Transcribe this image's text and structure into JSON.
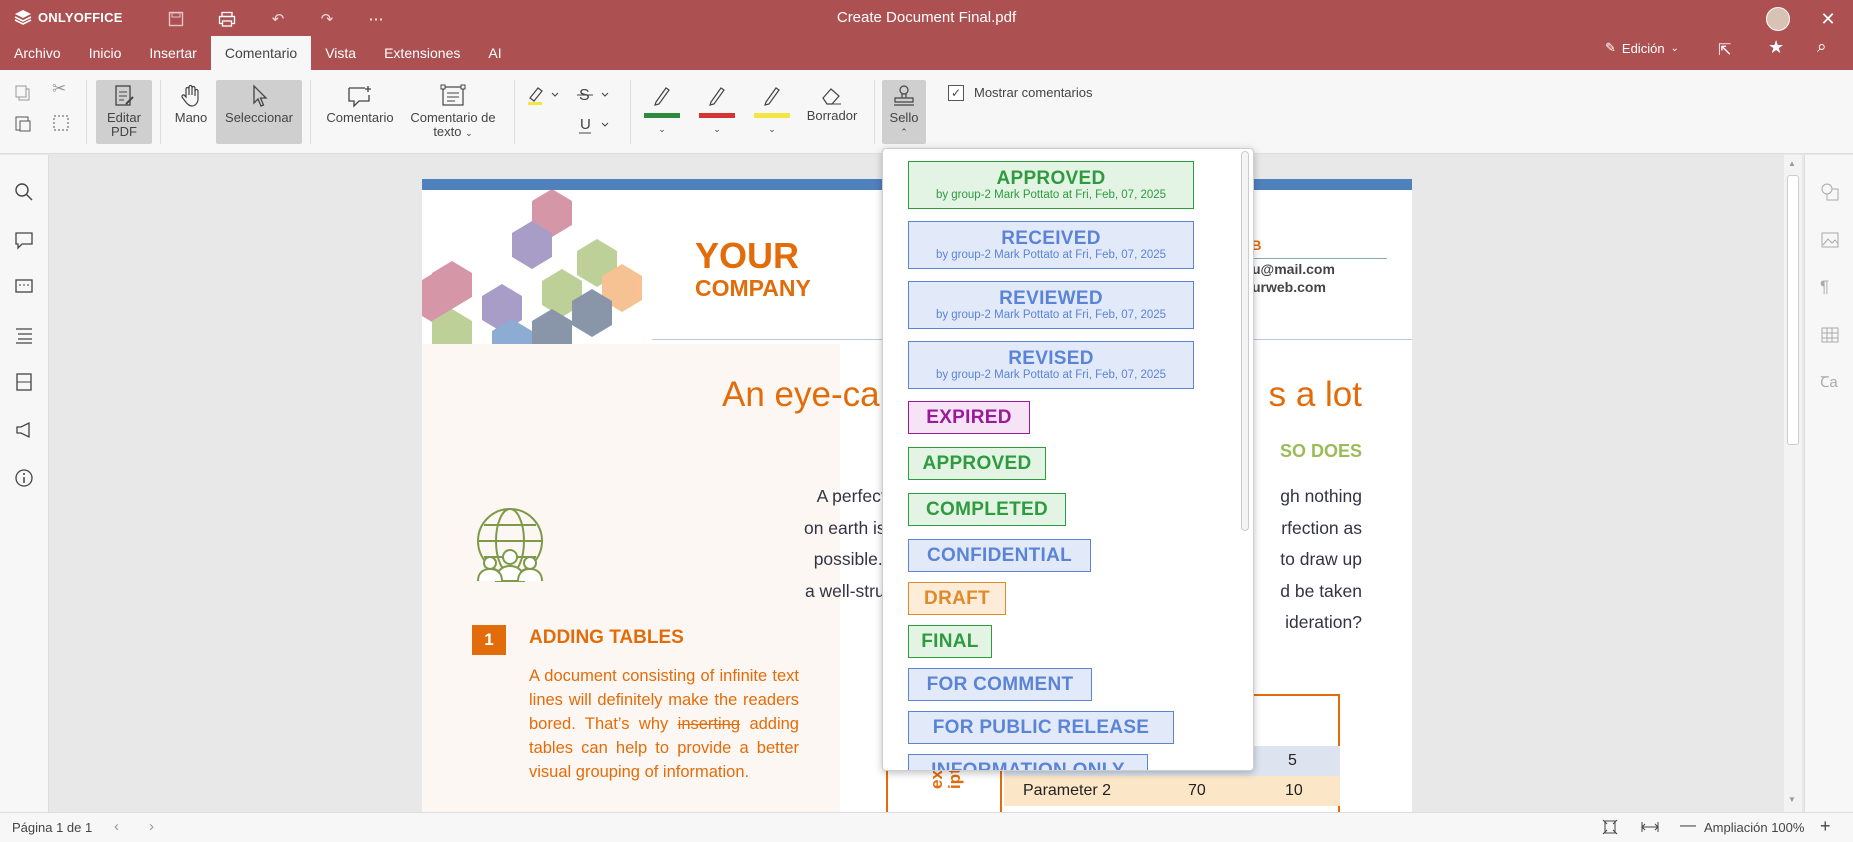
{
  "app": {
    "name": "ONLYOFFICE",
    "document_title": "Create Document Final.pdf"
  },
  "menu": {
    "items": [
      "Archivo",
      "Inicio",
      "Insertar",
      "Comentario",
      "Vista",
      "Extensiones",
      "AI"
    ],
    "active": "Comentario"
  },
  "header_right": {
    "mode_label": "Edición"
  },
  "ribbon": {
    "edit_pdf": "Editar PDF",
    "hand": "Mano",
    "select": "Seleccionar",
    "comment": "Comentario",
    "text_comment": "Comentario de texto",
    "eraser": "Borrador",
    "stamp": "Sello",
    "show_comments": "Mostrar comentarios",
    "pen_colors": [
      "#2e8b3e",
      "#d63333",
      "#f3e544"
    ],
    "highlight_color": "#f3e544"
  },
  "stamps": [
    {
      "label": "APPROVED",
      "sub": "by group-2 Mark Pottato at Fri, Feb, 07, 2025",
      "color": "#2e9b3e",
      "bg": "#e3f4e4"
    },
    {
      "label": "RECEIVED",
      "sub": "by group-2 Mark Pottato at Fri, Feb, 07, 2025",
      "color": "#5b84d6",
      "bg": "#e2eafa"
    },
    {
      "label": "REVIEWED",
      "sub": "by group-2 Mark Pottato at Fri, Feb, 07, 2025",
      "color": "#5b84d6",
      "bg": "#e2eafa"
    },
    {
      "label": "REVISED",
      "sub": "by group-2 Mark Pottato at Fri, Feb, 07, 2025",
      "color": "#5b84d6",
      "bg": "#e2eafa"
    },
    {
      "label": "EXPIRED",
      "color": "#9a1a9a",
      "bg": "#f6e4f6"
    },
    {
      "label": "APPROVED",
      "color": "#2e9b3e",
      "bg": "#e3f4e4"
    },
    {
      "label": "COMPLETED",
      "color": "#2e9b3e",
      "bg": "#e3f4e4"
    },
    {
      "label": "CONFIDENTIAL",
      "color": "#5b84d6",
      "bg": "#e2eafa"
    },
    {
      "label": "DRAFT",
      "color": "#e08a2a",
      "bg": "#fcecd8"
    },
    {
      "label": "FINAL",
      "color": "#2e9b3e",
      "bg": "#e3f4e4"
    },
    {
      "label": "FOR COMMENT",
      "color": "#5b84d6",
      "bg": "#e2eafa"
    },
    {
      "label": "FOR PUBLIC RELEASE",
      "color": "#5b84d6",
      "bg": "#e2eafa"
    },
    {
      "label": "INFORMATION ONLY",
      "color": "#5b84d6",
      "bg": "#e2eafa"
    }
  ],
  "document": {
    "logo_line1": "YOUR",
    "logo_line2": "COMPANY",
    "contact_head": "EB",
    "contact_email": "u@mail.com",
    "contact_web": "urweb.com",
    "headline_left": "An eye-ca",
    "headline_right": "s a lot",
    "subhead_right": "SO DOES",
    "body_left": [
      "A perfect document a",
      "on earth is perfect, any",
      "possible. Choosing ar",
      "a well-structured and p"
    ],
    "body_right": [
      "gh nothing",
      "rfection as",
      "to draw up",
      "d be taken",
      "ideration?"
    ],
    "section_number": "1",
    "section_title": "ADDING TABLES",
    "section_text_1": "A document consisting of infinite text lines will definitely make the readers bored. That’s why",
    "section_strike": "inserting",
    "section_text_2": "adding tables can help to provide a better visual grouping of information.",
    "table_side": "ext\niptio",
    "table_row1_v2": "5",
    "table_row2": {
      "name": "Parameter 2",
      "v1": "70",
      "v2": "10"
    }
  },
  "status": {
    "page": "Página 1 de 1",
    "zoom": "Ampliación 100%"
  }
}
